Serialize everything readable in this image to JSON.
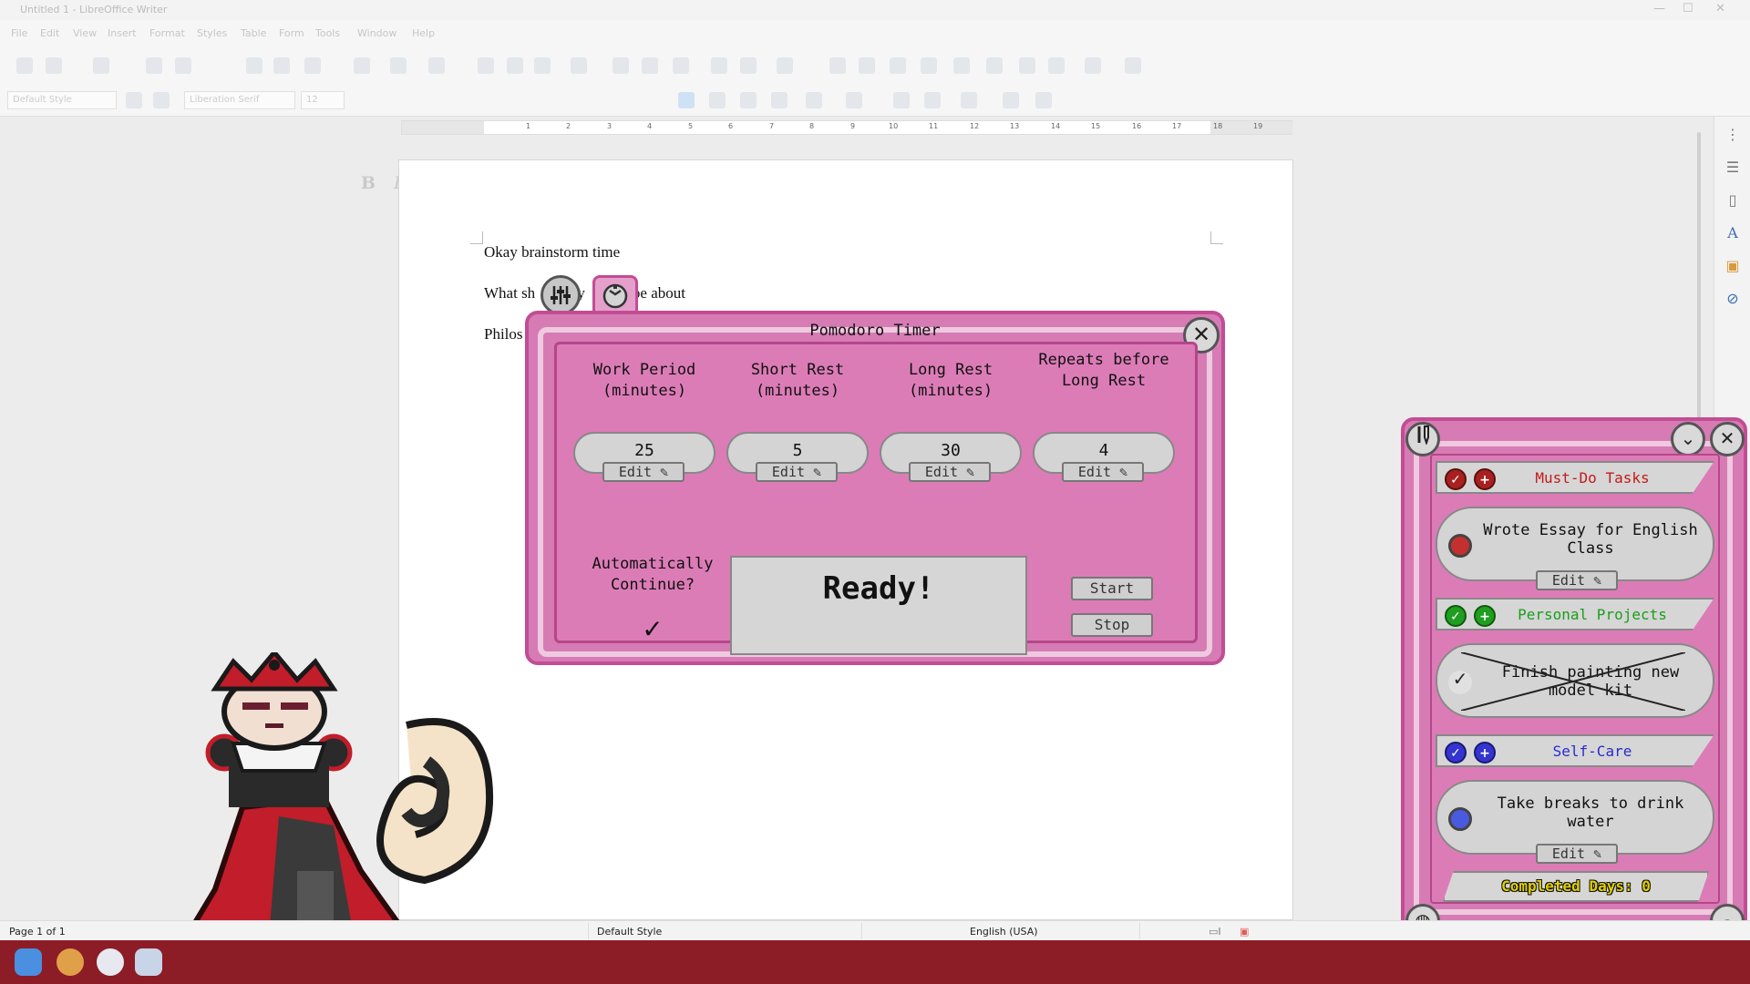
{
  "window": {
    "title": "Untitled 1 - LibreOffice Writer"
  },
  "menu": [
    "File",
    "Edit",
    "View",
    "Insert",
    "Format",
    "Styles",
    "Table",
    "Form",
    "Tools",
    "Window",
    "Help"
  ],
  "toolbar": {
    "paragraph_style": "Default Style",
    "font_name": "Liberation Serif",
    "font_size": "12"
  },
  "ruler_numbers": [
    "1",
    "2",
    "3",
    "4",
    "5",
    "6",
    "7",
    "8",
    "9",
    "10",
    "11",
    "12",
    "13",
    "14",
    "15",
    "16",
    "17",
    "18",
    "19"
  ],
  "document": {
    "lines": [
      "Okay brainstorm time",
      "What sh",
      "my",
      "be about",
      "Philos"
    ]
  },
  "statusbar": {
    "page": "Page 1 of 1",
    "style": "Default Style",
    "language": "English (USA)"
  },
  "pomodoro": {
    "title": "Pomodoro Timer",
    "settings": [
      {
        "label": "Work Period (minutes)",
        "value": "25"
      },
      {
        "label": "Short Rest (minutes)",
        "value": "5"
      },
      {
        "label": "Long Rest (minutes)",
        "value": "30"
      },
      {
        "label": "Repeats before Long Rest",
        "value": "4"
      }
    ],
    "edit_label": "Edit",
    "auto_continue_label": "Automatically Continue?",
    "auto_continue_checked": true,
    "status": "Ready!",
    "start_label": "Start",
    "stop_label": "Stop"
  },
  "tasks": {
    "categories": [
      {
        "name": "Must-Do Tasks",
        "color": "#c41a1a",
        "task": "Wrote Essay for English Class",
        "completed": false
      },
      {
        "name": "Personal Projects",
        "color": "#1a9e1a",
        "task": "Finish painting new model kit",
        "completed": true
      },
      {
        "name": "Self-Care",
        "color": "#2a2ad0",
        "task": "Take breaks to drink water",
        "completed": false
      }
    ],
    "edit_label": "Edit",
    "completed_days": "Completed Days: 0"
  },
  "colors": {
    "accent_pink": "#d77bb5",
    "border_pink": "#c24d95",
    "taskbar": "#8c1d26"
  }
}
